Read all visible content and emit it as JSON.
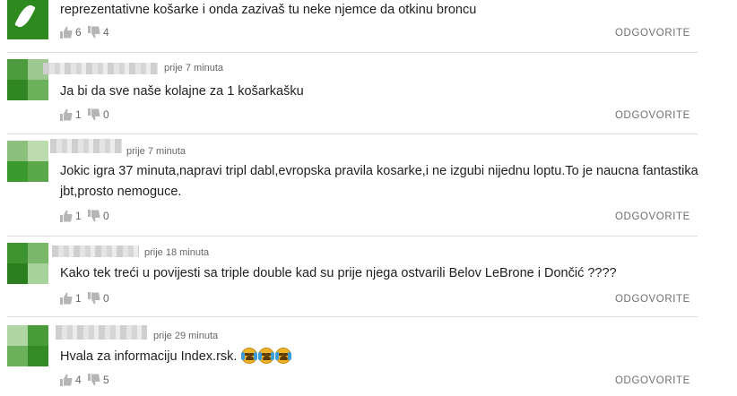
{
  "comments": [
    {
      "time": "",
      "text": "reprezentativne košarke i onda zazivaš tu neke njemce da otkinu broncu",
      "likes": "6",
      "dislikes": "4",
      "reply": "ODGOVORITE"
    },
    {
      "time": "prije 7 minuta",
      "text": "Ja bi da sve naše kolajne za 1 košarkašku",
      "likes": "1",
      "dislikes": "0",
      "reply": "ODGOVORITE"
    },
    {
      "time": "prije 7 minuta",
      "text": "Jokic igra 37 minuta,napravi tripl dabl,evropska pravila kosarke,i ne izgubi nijednu loptu.To je naucna fantastika jbt,prosto nemoguce.",
      "likes": "1",
      "dislikes": "0",
      "reply": "ODGOVORITE"
    },
    {
      "time": "prije 18 minuta",
      "text": "Kako tek treći u povijesti sa triple double kad su prije njega ostvarili Belov LeBrone i Dončić ????",
      "likes": "1",
      "dislikes": "0",
      "reply": "ODGOVORITE"
    },
    {
      "time": "prije 29 minuta",
      "text": "Hvala za informaciju Index.rsk.",
      "likes": "4",
      "dislikes": "5",
      "reply": "ODGOVORITE"
    }
  ],
  "colors": {
    "avatar_green": "#2e8a1e",
    "divider": "#dcdcdc",
    "meta_text": "#666666"
  },
  "icons": {
    "like": "thumbs-up-icon",
    "dislike": "thumbs-down-icon",
    "avatar_logo": "leaf-icon",
    "emoji": "crying-face-emoji"
  }
}
